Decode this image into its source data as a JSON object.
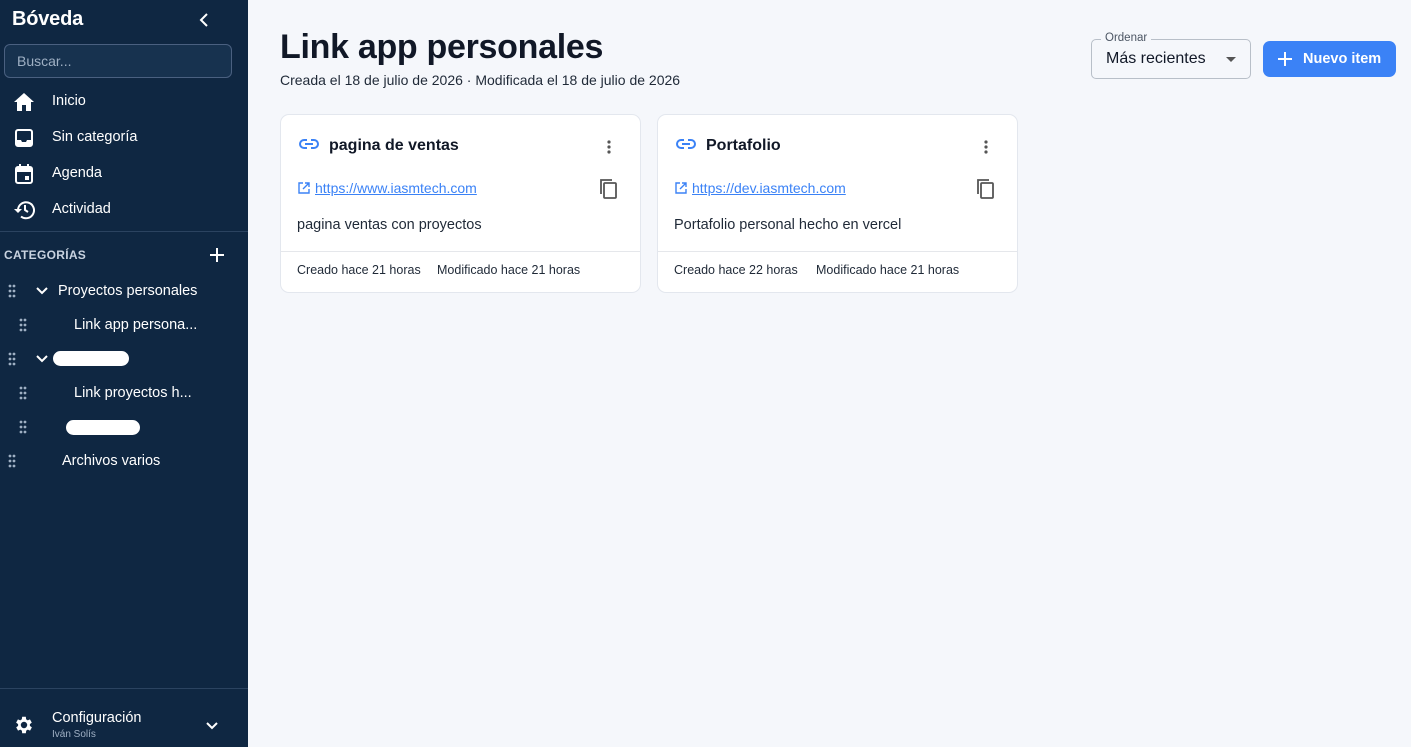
{
  "sidebar": {
    "brand": "Bóveda",
    "search_placeholder": "Buscar...",
    "nav": [
      {
        "label": "Inicio",
        "icon": "home-icon"
      },
      {
        "label": "Sin categoría",
        "icon": "inbox-icon"
      },
      {
        "label": "Agenda",
        "icon": "calendar-icon"
      },
      {
        "label": "Actividad",
        "icon": "history-icon"
      }
    ],
    "categories_header": "CATEGORÍAS",
    "tree": [
      {
        "label": "Proyectos personales",
        "expanded": true
      },
      {
        "label": "Link app persona..."
      },
      {
        "label": "",
        "expanded": true,
        "redacted": true
      },
      {
        "label": "Link proyectos h..."
      },
      {
        "label": "",
        "redacted": true
      },
      {
        "label": "Archivos varios"
      }
    ],
    "footer": {
      "title": "Configuración",
      "subtitle": "Iván Solís"
    }
  },
  "header": {
    "title": "Link app personales",
    "meta": "Creada el 18 de julio de 2026 · Modificada el 18 de julio de 2026",
    "sort": {
      "legend": "Ordenar",
      "value": "Más recientes"
    },
    "new_button": "Nuevo item"
  },
  "cards": [
    {
      "title": "pagina de ventas",
      "url": "https://www.iasmtech.com",
      "description": "pagina ventas con proyectos",
      "created": "Creado hace 21 horas",
      "modified": "Modificado hace 21 horas"
    },
    {
      "title": "Portafolio",
      "url": "https://dev.iasmtech.com",
      "description": "Portafolio personal hecho en vercel",
      "created": "Creado hace 22 horas",
      "modified": "Modificado hace 21 horas"
    }
  ],
  "colors": {
    "sidebar_bg": "#0f2742",
    "accent": "#3b82f6",
    "page_bg": "#f5f7fb"
  }
}
